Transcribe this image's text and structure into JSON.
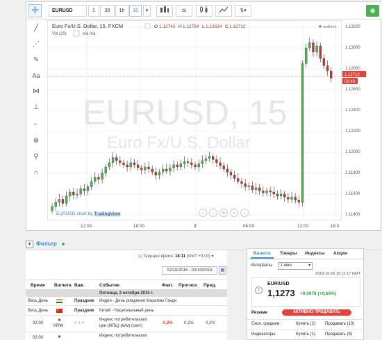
{
  "toolbar": {
    "symbol": "EURUSD",
    "intervals": [
      "1",
      "30",
      "1h",
      "15"
    ],
    "active_interval": "15"
  },
  "legend": {
    "title": "Euro Fx/U.S. Dollar, 15, FXCM",
    "ohlc": {
      "o_label": "O",
      "o": "1.12742",
      "h_label": "H",
      "h": "1.12784",
      "l_label": "L",
      "l": "1.12634",
      "c_label": "C",
      "c": "1.12712"
    },
    "vol": "Vol (20)",
    "vol_values": "n/a  n/a",
    "realtime": "realtime"
  },
  "watermark": {
    "symbol": "EURUSD, 15",
    "name": "Euro Fx/U.S. Dollar"
  },
  "attribution": {
    "prefix": "EURUSD chart by ",
    "link": "TradingView"
  },
  "colors": {
    "up": "#4caf50",
    "down": "#c0392b",
    "accent": "#3c8dd8",
    "price_line": "#e5403b"
  },
  "chart_data": {
    "type": "candlestick",
    "y_ticks": [
      "1.13200",
      "1.13000",
      "1.12800",
      "1.12600",
      "1.12400",
      "1.12200",
      "1.12000",
      "1.11800",
      "1.11600",
      "1.11400"
    ],
    "x_ticks": [
      "12:00",
      "18:00",
      "2",
      "06:00",
      "12:00",
      "16:0"
    ],
    "ylim": [
      1.1134,
      1.1326
    ],
    "last_price": "1.12712",
    "countdown": "02:40",
    "closes": [
      1.1148,
      1.1152,
      1.1155,
      1.1151,
      1.1158,
      1.1162,
      1.1159,
      1.116,
      1.1165,
      1.1163,
      1.1167,
      1.1172,
      1.1176,
      1.1174,
      1.118,
      1.1186,
      1.119,
      1.1195,
      1.1192,
      1.119,
      1.1188,
      1.1186,
      1.119,
      1.1188,
      1.1185,
      1.1183,
      1.1186,
      1.1184,
      1.1181,
      1.1178,
      1.1181,
      1.1184,
      1.1182,
      1.1185,
      1.1188,
      1.1186,
      1.1189,
      1.1191,
      1.119,
      1.1188,
      1.1186,
      1.1189,
      1.1192,
      1.1194,
      1.1196,
      1.1193,
      1.119,
      1.1187,
      1.1184,
      1.1181,
      1.1178,
      1.1175,
      1.1172,
      1.117,
      1.1167,
      1.1168,
      1.1164,
      1.1166,
      1.1163,
      1.1161,
      1.1163,
      1.1162,
      1.116,
      1.1158,
      1.116,
      1.1157,
      1.1155,
      1.1157,
      1.1154,
      1.1152,
      1.1285,
      1.13,
      1.1305,
      1.1296,
      1.1302,
      1.129,
      1.1283,
      1.1278,
      1.1271
    ]
  },
  "filter": {
    "label": "Фильтр"
  },
  "calendar": {
    "current_time_label": "Текущее время:",
    "current_time": "18:11",
    "tz": "(GMT +3:00)",
    "date_range": "02/10/2015 - 02/10/2015",
    "headers": {
      "time": "Время",
      "currency": "Валюта",
      "importance": "Важ.",
      "event": "Событие",
      "actual": "Факт.",
      "forecast": "Прогноз",
      "previous": "Пред."
    },
    "day": "Пятница, 2 октября 2015 г.",
    "rows": [
      {
        "time": "Весь День",
        "currency": "",
        "importance": "Праздник",
        "event": "Индия - День рождения Махатмы Ганди",
        "actual": "",
        "forecast": "",
        "previous": ""
      },
      {
        "time": "Весь День",
        "currency": "",
        "importance": "Праздник",
        "event": "Китай - Национальный день",
        "actual": "",
        "forecast": "",
        "previous": ""
      },
      {
        "time": "02:00",
        "currency": "KRW",
        "importance": "",
        "event": "Индекс потребительских цен (ИПЦ) (м/м) (сент)",
        "event_line1": "Индекс потребительских",
        "event_line2": "цен (ИПЦ) (м/м) (сент)",
        "actual": "-0,2%",
        "forecast": "0,2%",
        "previous": "0,2%"
      },
      {
        "time": "02:00",
        "currency": "KRW",
        "importance": "",
        "event": "Индекс потребительских",
        "actual": "",
        "forecast": "",
        "previous": ""
      }
    ]
  },
  "market": {
    "tabs": [
      "Валюта",
      "Товары",
      "Индексы",
      "Акции"
    ],
    "interval_label": "Интервалы",
    "interval_value": "1 мин",
    "timestamp": "2015-10-02 15:12:17 GMT",
    "quote": {
      "symbol": "EUR/USD",
      "price": "1,1273",
      "change": "+0,0078 (+0,69%)"
    },
    "summary_label": "Резюме",
    "summary_value": "АКТИВНО ПРОДАВАТЬ",
    "rows": [
      {
        "label": "Скол. средние:",
        "buy": "Купить (2)",
        "sell": "Продавать (10)"
      },
      {
        "label": "Индикаторы:",
        "buy": "Купить (1)",
        "sell": "Продавать (9)"
      }
    ]
  }
}
